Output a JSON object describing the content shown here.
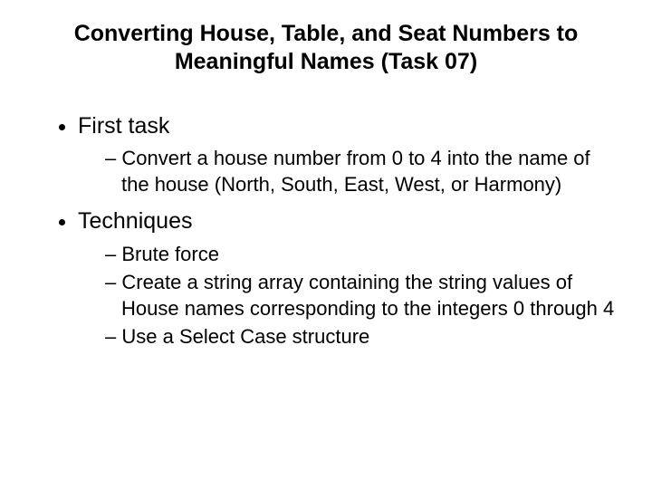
{
  "title": "Converting House, Table, and Seat Numbers to Meaningful Names (Task 07)",
  "bullets": [
    {
      "text": "First task",
      "sub": [
        "Convert a house number from 0 to 4 into the name of the house (North, South, East, West, or Harmony)"
      ]
    },
    {
      "text": "Techniques",
      "sub": [
        "Brute force",
        "Create a string array containing the string values of House names corresponding to the integers 0 through 4",
        "Use a Select Case structure"
      ]
    }
  ]
}
